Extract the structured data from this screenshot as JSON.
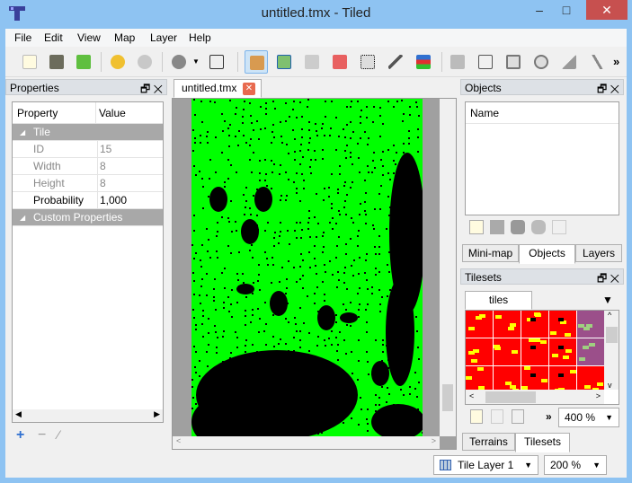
{
  "window": {
    "title": "untitled.tmx - Tiled",
    "minimize": "–",
    "maximize": "□",
    "close": "✕"
  },
  "menu": [
    "File",
    "Edit",
    "View",
    "Map",
    "Layer",
    "Help"
  ],
  "toolbar": {
    "icons": [
      "new-map-icon",
      "open-icon",
      "save-icon",
      "undo-icon",
      "redo-icon",
      "commands-icon",
      "random-mode-icon",
      "stamp-brush-icon",
      "terrain-brush-icon",
      "bucket-fill-icon",
      "eraser-icon",
      "rect-select-icon",
      "magic-wand-icon",
      "select-same-tile-icon",
      "select-objects-icon",
      "edit-polygons-icon",
      "insert-rectangle-icon",
      "insert-ellipse-icon",
      "insert-polygon-icon",
      "insert-polyline-icon"
    ],
    "overflow": "»",
    "active": "stamp-brush-icon"
  },
  "properties": {
    "title": "Properties",
    "columns": [
      "Property",
      "Value"
    ],
    "groups": [
      {
        "name": "Tile",
        "rows": [
          {
            "key": "ID",
            "value": "15",
            "readonly": true
          },
          {
            "key": "Width",
            "value": "8",
            "readonly": true
          },
          {
            "key": "Height",
            "value": "8",
            "readonly": true
          },
          {
            "key": "Probability",
            "value": "1,000",
            "readonly": false
          }
        ]
      },
      {
        "name": "Custom Properties",
        "rows": []
      }
    ]
  },
  "document_tab": {
    "label": "untitled.tmx"
  },
  "objects": {
    "title": "Objects",
    "column": "Name",
    "tabs": [
      "Mini-map",
      "Objects",
      "Layers"
    ],
    "selected_tab": "Objects"
  },
  "tilesets": {
    "title": "Tilesets",
    "tab": "tiles",
    "zoom": "400 %",
    "overflow": "»",
    "bottom_tabs": [
      "Terrains",
      "Tilesets"
    ],
    "selected_tab": "Tilesets"
  },
  "status": {
    "layer": "Tile Layer 1",
    "zoom": "200 %"
  },
  "colors": {
    "map_green": "#00ff00",
    "tile_red": "#ff0000",
    "tile_yellow": "#ffff00",
    "tile_purple": "#9b4f8a",
    "window_frame": "#8ec3f2"
  }
}
